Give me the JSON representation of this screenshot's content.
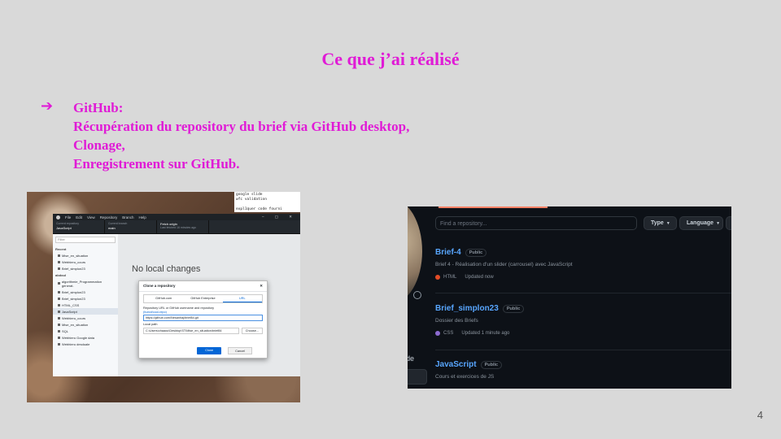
{
  "slide": {
    "title": "Ce que j’ai réalisé",
    "bullet_arrow": "➔",
    "lines": [
      "GitHub:",
      "Récupération du repository du brief via GitHub desktop,",
      "Clonage,",
      "Enregistrement sur GitHub."
    ],
    "page_number": "4"
  },
  "desktop": {
    "notes": [
      "google slide",
      "wfc validation",
      "",
      "expl1quer code fourni"
    ],
    "menu": [
      "File",
      "Edit",
      "View",
      "Repository",
      "Branch",
      "Help"
    ],
    "current_repo_label": "Current repository",
    "current_repo": "JavaScript",
    "current_branch_label": "Current branch",
    "current_branch": "main",
    "fetch_label": "Fetch origin",
    "fetch_sub": "Last fetched 16 minutes ago",
    "filter_placeholder": "Filter",
    "add_label": "Add",
    "recent_label": "Recent",
    "recent": [
      "Mise_en_situation",
      "Webhieru_cours",
      "Brief_simplon23"
    ],
    "other_label": "abdoul",
    "others": [
      "algorithmie_Programmation generat.",
      "Brief_simplon23",
      "Brief_simplon23",
      "HTML_CSS",
      "JavaScript",
      "Webhieru_cours",
      "Mise_en_situation",
      "SQL",
      "Webhieru Google data",
      "Webhieru desduale"
    ],
    "no_changes": "No local changes",
    "modal": {
      "title": "Clone a repository",
      "tabs": [
        "GitHub.com",
        "GitHub Enterprise",
        "URL"
      ],
      "url_label": "Repository URL or GitHub username and repository",
      "url_hint": "(hubot/cool-repo)",
      "url_value": "https://github.com/Nesanhaj/brief84.git",
      "path_label": "Local path",
      "path_value": "C:\\Users\\chaaou\\Desktop\\ST\\Mise_en_situation\\brief84",
      "choose": "Choose...",
      "clone": "Clone",
      "cancel": "Cancel"
    }
  },
  "github": {
    "search_placeholder": "Find a repository...",
    "type_label": "Type",
    "language_label": "Language",
    "side_text": "de",
    "repos": [
      {
        "name": "Brief-4",
        "visibility": "Public",
        "description": "Brief 4 - Réalisation d'un slider (carrousel) avec JavaScript",
        "language": "HTML",
        "language_color": "#e34c26",
        "updated": "Updated now"
      },
      {
        "name": "Brief_simplon23",
        "visibility": "Public",
        "description": "Dossier des Briefs",
        "language": "CSS",
        "language_color": "#563d7c",
        "updated": "Updated 1 minute ago"
      },
      {
        "name": "JavaScript",
        "visibility": "Public",
        "description": "Cours et exercices de JS",
        "language": "",
        "language_color": "",
        "updated": ""
      }
    ]
  }
}
